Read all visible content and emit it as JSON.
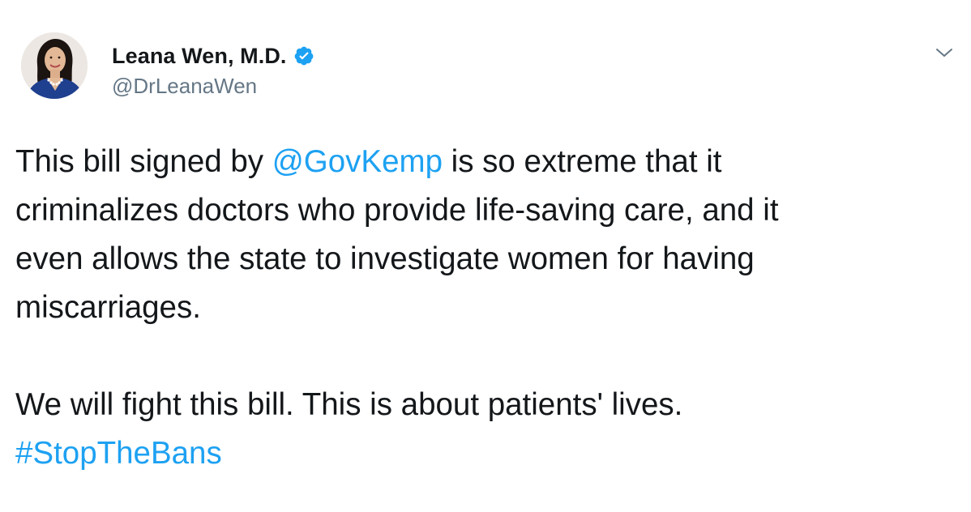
{
  "author": {
    "display_name": "Leana Wen, M.D.",
    "handle": "@DrLeanaWen",
    "verified": true,
    "avatar_icon": "profile-photo"
  },
  "menu": {
    "icon": "chevron-down-icon"
  },
  "tweet": {
    "para1_before_mention": "This bill signed by ",
    "mention": "@GovKemp",
    "para1_line1_after": " is so extreme that it",
    "para1_line2": "criminalizes doctors who provide life-saving care, and it",
    "para1_line3": "even allows the state to investigate women for having",
    "para1_line4": "miscarriages.",
    "para2_line1": "We will fight this bill. This is about patients' lives.",
    "hashtag": "#StopTheBans"
  },
  "colors": {
    "text": "#14171a",
    "link": "#1da1f2",
    "secondary": "#657786",
    "verified_badge": "#1da1f2"
  }
}
